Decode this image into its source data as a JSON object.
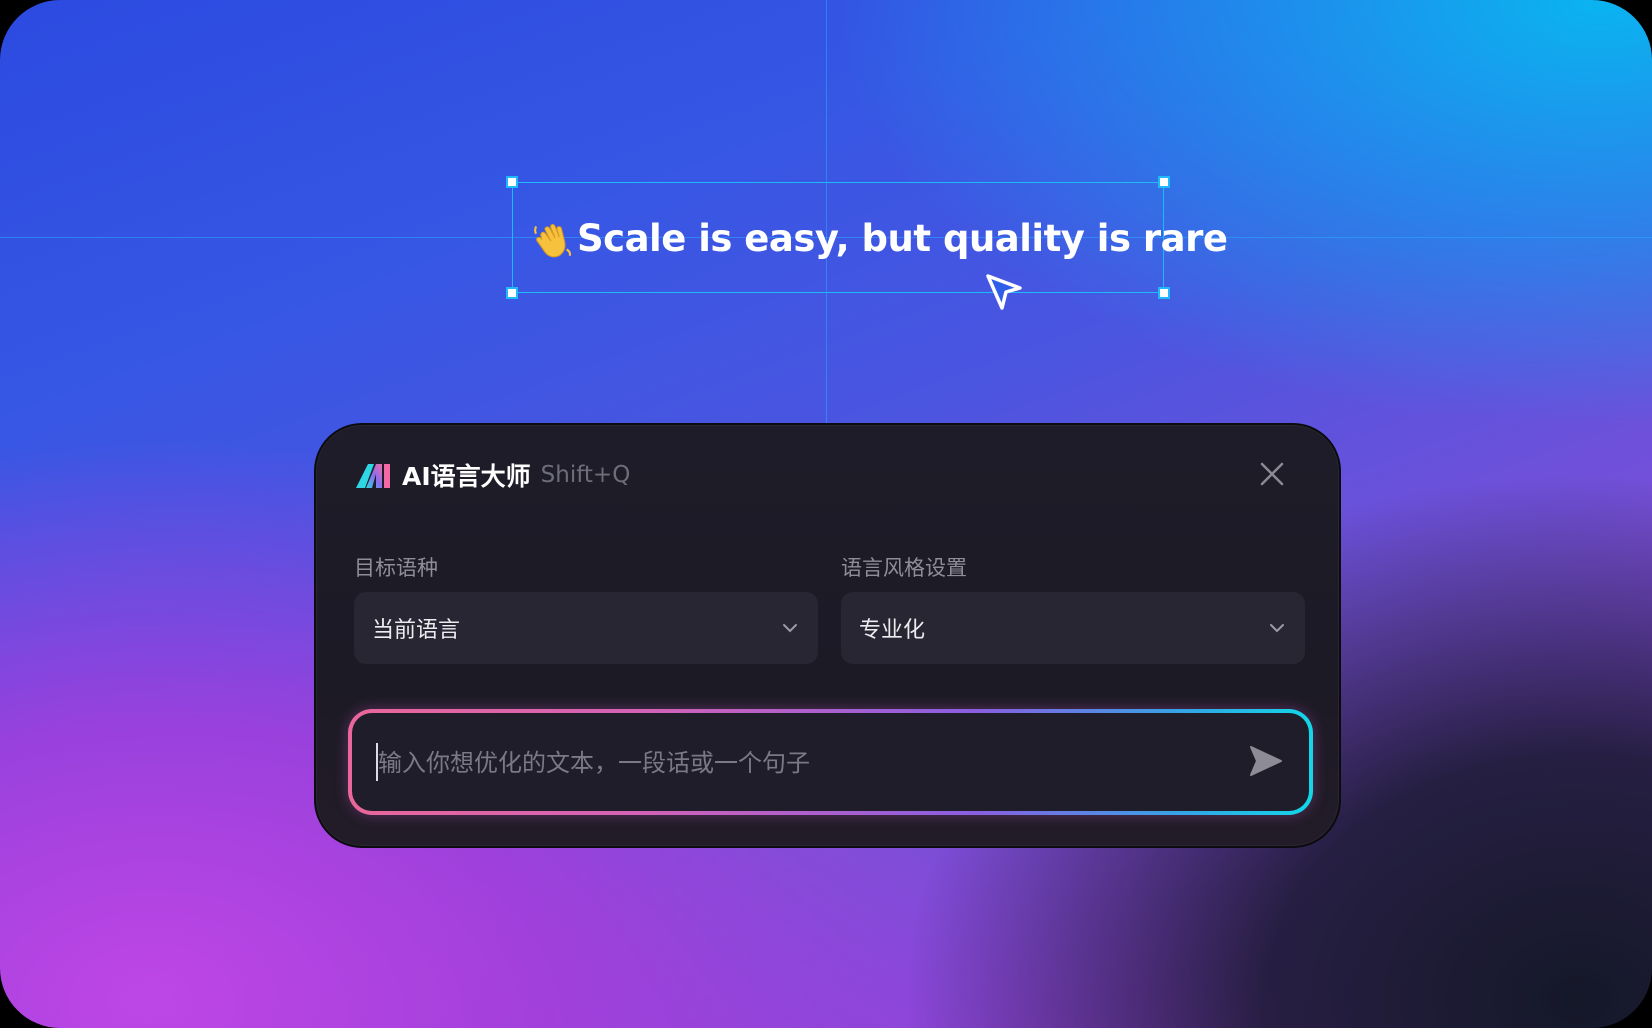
{
  "canvas": {
    "selected_text": "Scale is easy, but quality is rare",
    "emoji_icon": "waving-hand-icon"
  },
  "panel": {
    "title": "AI语言大师",
    "shortcut": "Shift+Q",
    "logo_icon": "ai-logo-icon",
    "close_icon": "close-icon",
    "target_language": {
      "label": "目标语种",
      "value": "当前语言"
    },
    "style_setting": {
      "label": "语言风格设置",
      "value": "专业化"
    },
    "input": {
      "value": "",
      "placeholder": "输入你想优化的文本，一段话或一个句子"
    },
    "send_icon": "send-icon"
  },
  "colors": {
    "selection": "#20b8ff",
    "panel_bg": "#1d1c28",
    "select_bg": "#272632",
    "gradient_pink": "#e9679a",
    "gradient_cyan": "#12d8e8"
  }
}
